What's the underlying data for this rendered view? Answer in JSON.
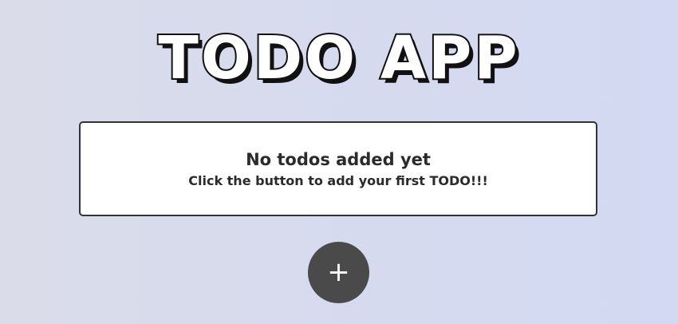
{
  "header": {
    "title": "TODO APP"
  },
  "empty_state": {
    "heading": "No todos added yet",
    "subtext": "Click the button to add your first TODO!!!"
  },
  "add_button": {
    "label": "+",
    "icon": "plus-icon"
  },
  "colors": {
    "background_start": "#dadce9",
    "background_end": "#d3d9f3",
    "button": "#4a4a4a",
    "text": "#2b2b2b"
  }
}
